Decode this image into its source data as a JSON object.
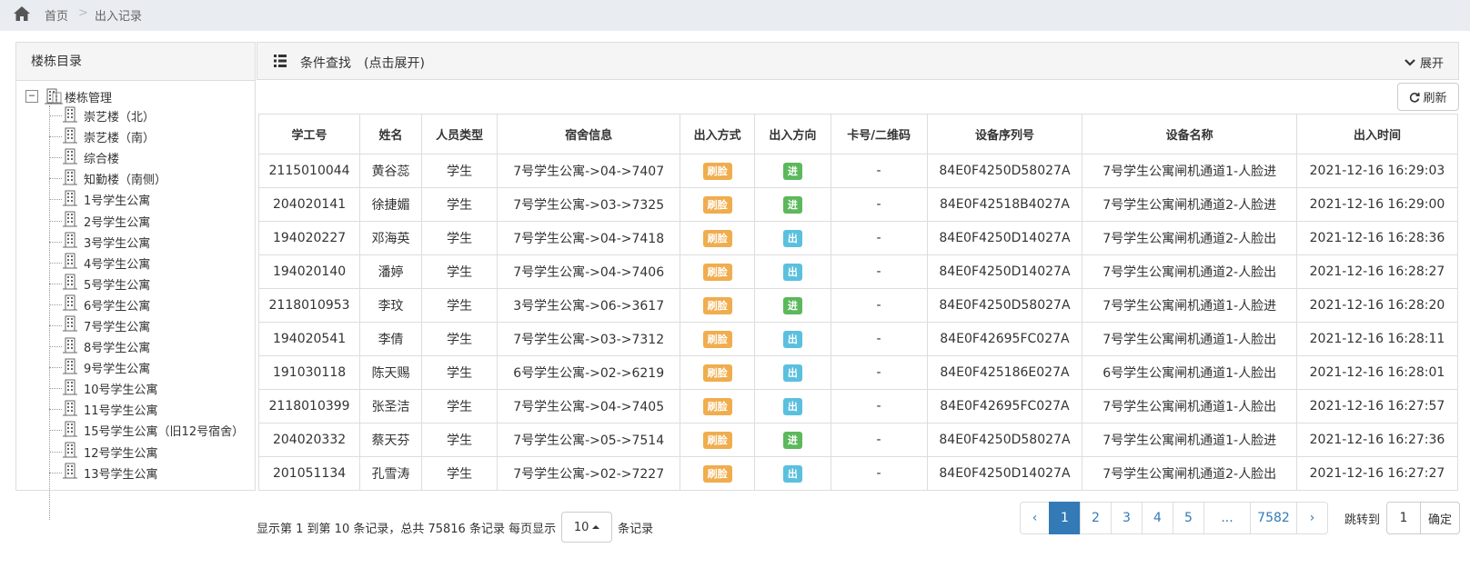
{
  "breadcrumb": {
    "home": "首页",
    "sep": ">",
    "current": "出入记录"
  },
  "sidebar": {
    "title": "楼栋目录",
    "root": {
      "toggle": "−",
      "label": "楼栋管理"
    },
    "items": [
      "崇艺楼（北）",
      "崇艺楼（南）",
      "综合楼",
      "知勤楼（南侧）",
      "1号学生公寓",
      "2号学生公寓",
      "3号学生公寓",
      "4号学生公寓",
      "5号学生公寓",
      "6号学生公寓",
      "7号学生公寓",
      "8号学生公寓",
      "9号学生公寓",
      "10号学生公寓",
      "11号学生公寓",
      "15号学生公寓（旧12号宿舍）",
      "12号学生公寓",
      "13号学生公寓"
    ]
  },
  "search": {
    "title": "条件查找　(点击展开)",
    "expand_label": "展开"
  },
  "toolbar": {
    "refresh_label": "刷新"
  },
  "table": {
    "headers": [
      "学工号",
      "姓名",
      "人员类型",
      "宿舍信息",
      "出入方式",
      "出入方向",
      "卡号/二维码",
      "设备序列号",
      "设备名称",
      "出入时间"
    ],
    "rows": [
      [
        "2115010044",
        "黄谷蕊",
        "学生",
        "7号学生公寓->04->7407",
        "刷脸",
        "进",
        "-",
        "84E0F4250D58027A",
        "7号学生公寓闸机通道1-人脸进",
        "2021-12-16 16:29:03"
      ],
      [
        "204020141",
        "徐捷媚",
        "学生",
        "7号学生公寓->03->7325",
        "刷脸",
        "进",
        "-",
        "84E0F42518B4027A",
        "7号学生公寓闸机通道2-人脸进",
        "2021-12-16 16:29:00"
      ],
      [
        "194020227",
        "邓海英",
        "学生",
        "7号学生公寓->04->7418",
        "刷脸",
        "出",
        "-",
        "84E0F4250D14027A",
        "7号学生公寓闸机通道2-人脸出",
        "2021-12-16 16:28:36"
      ],
      [
        "194020140",
        "潘婷",
        "学生",
        "7号学生公寓->04->7406",
        "刷脸",
        "出",
        "-",
        "84E0F4250D14027A",
        "7号学生公寓闸机通道2-人脸出",
        "2021-12-16 16:28:27"
      ],
      [
        "2118010953",
        "李玟",
        "学生",
        "3号学生公寓->06->3617",
        "刷脸",
        "进",
        "-",
        "84E0F4250D58027A",
        "7号学生公寓闸机通道1-人脸进",
        "2021-12-16 16:28:20"
      ],
      [
        "194020541",
        "李倩",
        "学生",
        "7号学生公寓->03->7312",
        "刷脸",
        "出",
        "-",
        "84E0F42695FC027A",
        "7号学生公寓闸机通道1-人脸出",
        "2021-12-16 16:28:11"
      ],
      [
        "191030118",
        "陈天赐",
        "学生",
        "6号学生公寓->02->6219",
        "刷脸",
        "出",
        "-",
        "84E0F425186E027A",
        "6号学生公寓闸机通道1-人脸出",
        "2021-12-16 16:28:01"
      ],
      [
        "2118010399",
        "张圣洁",
        "学生",
        "7号学生公寓->04->7405",
        "刷脸",
        "出",
        "-",
        "84E0F42695FC027A",
        "7号学生公寓闸机通道1-人脸出",
        "2021-12-16 16:27:57"
      ],
      [
        "204020332",
        "蔡天芬",
        "学生",
        "7号学生公寓->05->7514",
        "刷脸",
        "进",
        "-",
        "84E0F4250D58027A",
        "7号学生公寓闸机通道1-人脸进",
        "2021-12-16 16:27:36"
      ],
      [
        "201051134",
        "孔雪涛",
        "学生",
        "7号学生公寓->02->7227",
        "刷脸",
        "出",
        "-",
        "84E0F4250D14027A",
        "7号学生公寓闸机通道2-人脸出",
        "2021-12-16 16:27:27"
      ]
    ]
  },
  "footer": {
    "info_prefix": "显示第 1 到第 10 条记录，总共 75816 条记录 每页显示",
    "page_size": "10",
    "info_suffix": "条记录"
  },
  "pagination": {
    "prev": "‹",
    "pages": [
      "1",
      "2",
      "3",
      "4",
      "5",
      "...",
      "7582"
    ],
    "next": "›",
    "active_page": "1",
    "jump_label": "跳转到",
    "jump_value": "1",
    "confirm_label": "确定"
  },
  "colors": {
    "face_badge": "#f0ad4e",
    "in_badge": "#5cb85c",
    "out_badge": "#5bc0de",
    "primary": "#337ab7"
  }
}
